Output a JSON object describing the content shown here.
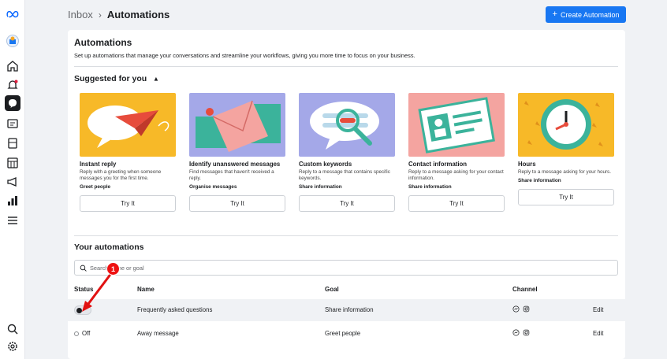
{
  "header": {
    "breadcrumb_root": "Inbox",
    "breadcrumb_current": "Automations",
    "create_button": "Create Automation"
  },
  "main": {
    "title": "Automations",
    "subtitle": "Set up automations that manage your conversations and streamline your workflows, giving you more time to focus on your business.",
    "suggested_title": "Suggested for you",
    "suggestions": [
      {
        "name": "Instant reply",
        "desc": "Reply with a greeting when someone messages you for the first time.",
        "goal": "Greet people",
        "button": "Try It"
      },
      {
        "name": "Identify unanswered messages",
        "desc": "Find messages that haven't received a reply.",
        "goal": "Organise messages",
        "button": "Try It"
      },
      {
        "name": "Custom keywords",
        "desc": "Reply to a message that contains specific keywords.",
        "goal": "Share information",
        "button": "Try It"
      },
      {
        "name": "Contact information",
        "desc": "Reply to a message asking for your contact information.",
        "goal": "Share information",
        "button": "Try It"
      },
      {
        "name": "Hours",
        "desc": "Reply to a message asking for your hours.",
        "goal": "Share information",
        "button": "Try It"
      }
    ],
    "your_title": "Your automations",
    "search_placeholder": "Search name or goal",
    "columns": {
      "status": "Status",
      "name": "Name",
      "goal": "Goal",
      "channel": "Channel"
    },
    "rows": [
      {
        "status": "On",
        "name": "Frequently asked questions",
        "goal": "Share information",
        "edit": "Edit"
      },
      {
        "status": "Off",
        "name": "Away message",
        "goal": "Greet people",
        "edit": "Edit"
      }
    ]
  },
  "annotation": {
    "step": "1"
  },
  "colors": {
    "accent": "#1877f2",
    "annotation": "#e11111"
  },
  "icons": [
    "meta-logo-icon",
    "page-avatar-icon",
    "home-icon",
    "notifications-icon",
    "inbox-icon",
    "content-icon",
    "posts-icon",
    "planner-icon",
    "ads-icon",
    "insights-icon",
    "menu-icon",
    "search-icon",
    "settings-icon",
    "messenger-icon",
    "instagram-icon"
  ]
}
